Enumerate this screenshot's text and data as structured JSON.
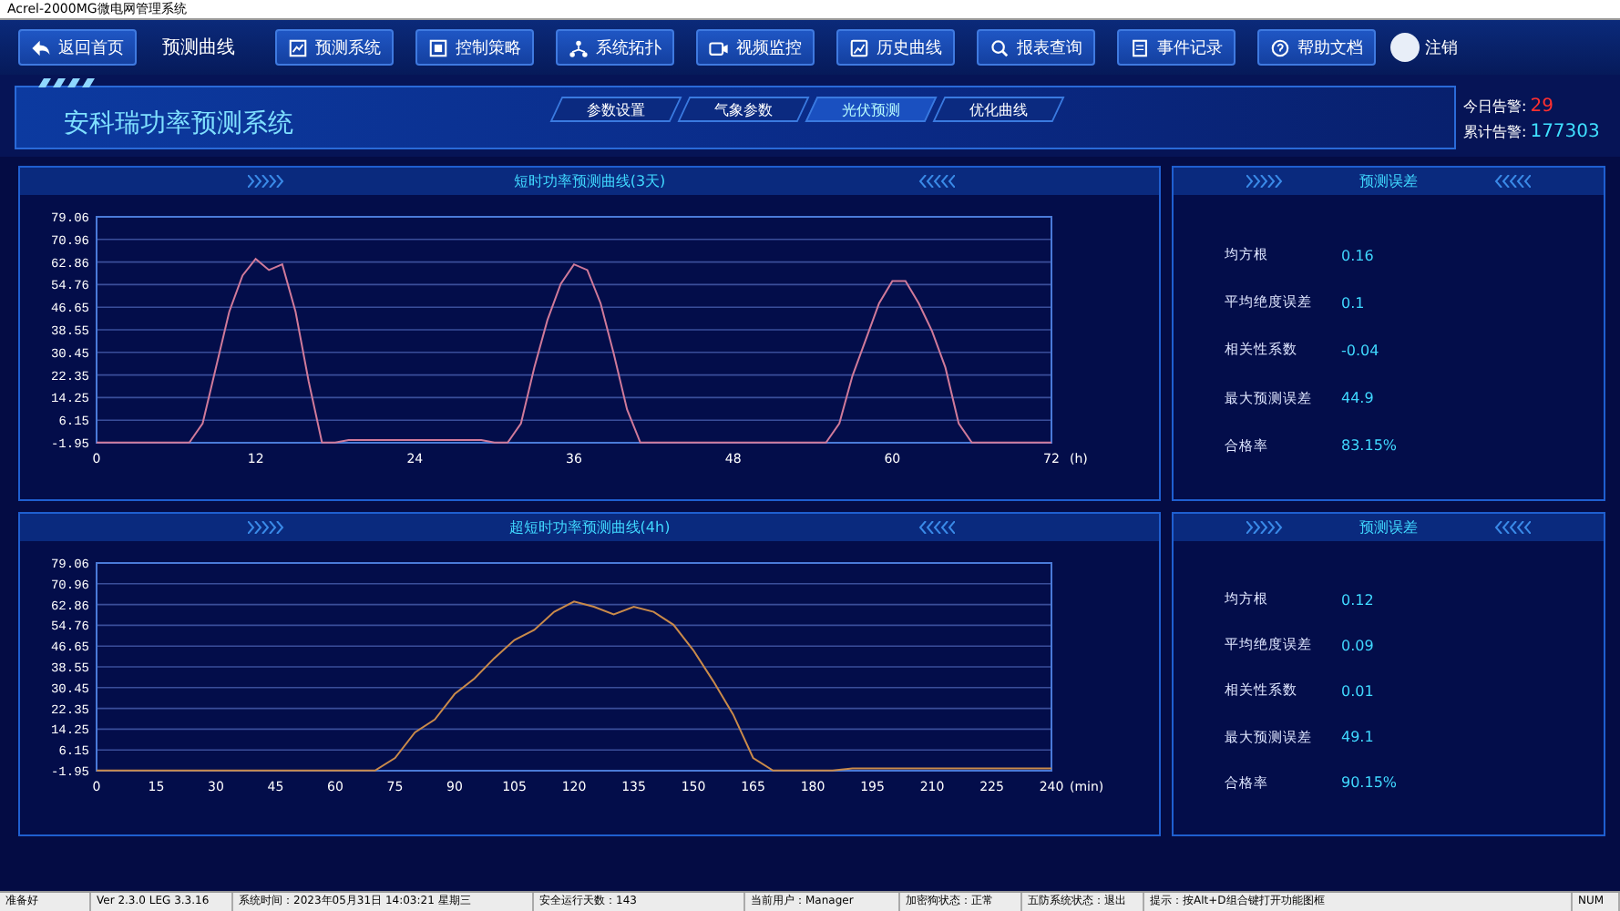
{
  "window": {
    "title": "Acrel-2000MG微电网管理系统"
  },
  "nav": {
    "back": {
      "label": "返回首页"
    },
    "page_title": "预测曲线",
    "buttons": [
      {
        "label": "预测系统"
      },
      {
        "label": "控制策略"
      },
      {
        "label": "系统拓扑"
      },
      {
        "label": "视频监控"
      },
      {
        "label": "历史曲线"
      },
      {
        "label": "报表查询"
      },
      {
        "label": "事件记录"
      },
      {
        "label": "帮助文档"
      }
    ],
    "user": {
      "label": "注销"
    }
  },
  "header": {
    "title": "安科瑞功率预测系统",
    "tabs": [
      {
        "label": "参数设置",
        "selected": false
      },
      {
        "label": "气象参数",
        "selected": false
      },
      {
        "label": "光伏预测",
        "selected": true
      },
      {
        "label": "优化曲线",
        "selected": false
      }
    ],
    "alarms": [
      {
        "label": "今日告警:",
        "value": "29",
        "kind": "today"
      },
      {
        "label": "累计告警:",
        "value": "177303",
        "kind": "total"
      }
    ]
  },
  "panels": [
    {
      "chart": {
        "title": "短时功率预测曲线(3天)",
        "chart_data": {
          "type": "line",
          "xlabel": "(h)",
          "x": [
            0,
            1,
            2,
            3,
            4,
            5,
            6,
            7,
            8,
            9,
            10,
            11,
            12,
            13,
            14,
            15,
            16,
            17,
            18,
            19,
            20,
            21,
            22,
            23,
            24,
            25,
            26,
            27,
            28,
            29,
            30,
            31,
            32,
            33,
            34,
            35,
            36,
            37,
            38,
            39,
            40,
            41,
            42,
            43,
            44,
            45,
            46,
            47,
            48,
            49,
            50,
            51,
            52,
            53,
            54,
            55,
            56,
            57,
            58,
            59,
            60,
            61,
            62,
            63,
            64,
            65,
            66,
            67,
            68,
            69,
            70,
            71,
            72
          ],
          "series": [
            {
              "color": "#d07a9a",
              "values": [
                -1.9,
                -1.9,
                -1.9,
                -1.9,
                -1.9,
                -1.9,
                -1.9,
                -1.9,
                5,
                25,
                45,
                58,
                64,
                60,
                62,
                45,
                20,
                -1.9,
                -1.9,
                -1,
                -1,
                -1,
                -1,
                -1,
                -1,
                -1,
                -1,
                -1,
                -1,
                -1,
                -1.9,
                -1.9,
                5,
                25,
                42,
                55,
                62,
                60,
                48,
                30,
                10,
                -1.9,
                -1.9,
                -1.9,
                -1.9,
                -1.9,
                -1.9,
                -1.9,
                -1.9,
                -1.9,
                -1.9,
                -1.9,
                -1.9,
                -1.9,
                -1.9,
                -1.9,
                5,
                22,
                35,
                48,
                56,
                56,
                48,
                38,
                25,
                5,
                -1.9,
                -1.9,
                -1.9,
                -1.9,
                -1.9,
                -1.9,
                -1.9
              ]
            }
          ],
          "grid": true,
          "xlim": [
            0,
            72
          ],
          "ylim": [
            -1.95,
            79.06
          ],
          "xticks": [
            0,
            12,
            24,
            36,
            48,
            60,
            72
          ],
          "yticks": [
            -1.95,
            6.15,
            14.25,
            22.35,
            30.45,
            38.55,
            46.65,
            54.76,
            62.86,
            70.96,
            79.06
          ]
        }
      },
      "stats": {
        "title": "预测误差",
        "rows": [
          {
            "label": "均方根",
            "value": "0.16"
          },
          {
            "label": "平均绝度误差",
            "value": "0.1"
          },
          {
            "label": "相关性系数",
            "value": "-0.04"
          },
          {
            "label": "最大预测误差",
            "value": "44.9"
          },
          {
            "label": "合格率",
            "value": "83.15%"
          }
        ]
      }
    },
    {
      "chart": {
        "title": "超短时功率预测曲线(4h)",
        "chart_data": {
          "type": "line",
          "xlabel": "(min)",
          "x": [
            0,
            5,
            10,
            15,
            20,
            25,
            30,
            35,
            40,
            45,
            50,
            55,
            60,
            65,
            70,
            75,
            80,
            85,
            90,
            95,
            100,
            105,
            110,
            115,
            120,
            125,
            130,
            135,
            140,
            145,
            150,
            155,
            160,
            165,
            170,
            175,
            180,
            185,
            190,
            195,
            200,
            205,
            210,
            215,
            220,
            225,
            230,
            235,
            240
          ],
          "series": [
            {
              "color": "#c98a4a",
              "values": [
                -1.9,
                -1.9,
                -1.9,
                -1.9,
                -1.9,
                -1.9,
                -1.9,
                -1.9,
                -1.9,
                -1.9,
                -1.9,
                -1.9,
                -1.9,
                -1.9,
                -1.9,
                3,
                13,
                18,
                28,
                34,
                42,
                49,
                53,
                60,
                64,
                62,
                59,
                62,
                60,
                55,
                45,
                33,
                20,
                3,
                -1.9,
                -1.9,
                -1.9,
                -1.9,
                -1,
                -1,
                -1,
                -1,
                -1,
                -1,
                -1,
                -1,
                -1,
                -1,
                -1
              ]
            }
          ],
          "grid": true,
          "xlim": [
            0,
            240
          ],
          "ylim": [
            -1.95,
            79.06
          ],
          "xticks": [
            0,
            15,
            30,
            45,
            60,
            75,
            90,
            105,
            120,
            135,
            150,
            165,
            180,
            195,
            210,
            225,
            240
          ],
          "yticks": [
            -1.95,
            6.15,
            14.25,
            22.35,
            30.45,
            38.55,
            46.65,
            54.76,
            62.86,
            70.96,
            79.06
          ]
        }
      },
      "stats": {
        "title": "预测误差",
        "rows": [
          {
            "label": "均方根",
            "value": "0.12"
          },
          {
            "label": "平均绝度误差",
            "value": "0.09"
          },
          {
            "label": "相关性系数",
            "value": "0.01"
          },
          {
            "label": "最大预测误差",
            "value": "49.1"
          },
          {
            "label": "合格率",
            "value": "90.15%"
          }
        ]
      }
    }
  ],
  "status_bar": [
    "准备好",
    "Ver 2.3.0 LEG 3.3.16",
    "系统时间：2023年05月31日  14:03:21  星期三",
    "安全运行天数：143",
    "当前用户：Manager",
    "加密狗状态：正常",
    "五防系统状态：退出",
    "提示：按Alt+D组合键打开功能图框",
    "NUM"
  ]
}
